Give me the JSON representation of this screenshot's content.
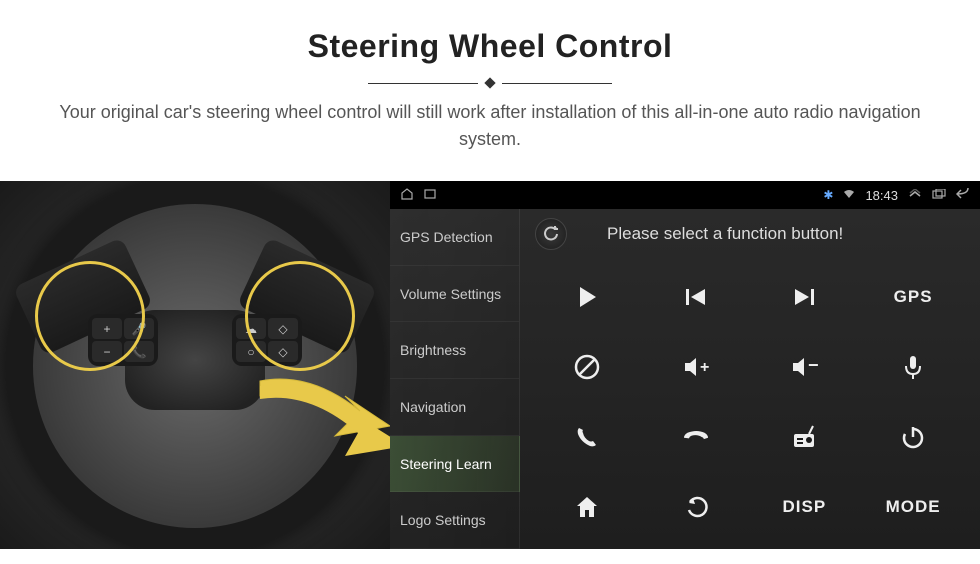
{
  "header": {
    "title": "Steering Wheel Control",
    "subtitle": "Your original car's steering wheel control will still work after installation of this all-in-one auto radio navigation system."
  },
  "status_bar": {
    "time": "18:43"
  },
  "sidebar": {
    "items": [
      {
        "label": "GPS Detection",
        "active": false
      },
      {
        "label": "Volume Settings",
        "active": false
      },
      {
        "label": "Brightness",
        "active": false
      },
      {
        "label": "Navigation",
        "active": false
      },
      {
        "label": "Steering Learn",
        "active": true
      },
      {
        "label": "Logo Settings",
        "active": false
      }
    ]
  },
  "content": {
    "instruction": "Please select a function button!",
    "buttons": [
      {
        "name": "play",
        "label": ""
      },
      {
        "name": "prev-track",
        "label": ""
      },
      {
        "name": "next-track",
        "label": ""
      },
      {
        "name": "gps",
        "label": "GPS"
      },
      {
        "name": "mute",
        "label": ""
      },
      {
        "name": "volume-up",
        "label": ""
      },
      {
        "name": "volume-down",
        "label": ""
      },
      {
        "name": "mic",
        "label": ""
      },
      {
        "name": "answer-call",
        "label": ""
      },
      {
        "name": "end-call",
        "label": ""
      },
      {
        "name": "radio",
        "label": ""
      },
      {
        "name": "power",
        "label": ""
      },
      {
        "name": "home",
        "label": ""
      },
      {
        "name": "back",
        "label": ""
      },
      {
        "name": "disp",
        "label": "DISP"
      },
      {
        "name": "mode",
        "label": "MODE"
      }
    ]
  },
  "wheel_pad": {
    "left": [
      "+",
      "🎤",
      "−",
      "📞"
    ],
    "right": [
      "☁",
      "◇",
      "○",
      "◇"
    ]
  }
}
